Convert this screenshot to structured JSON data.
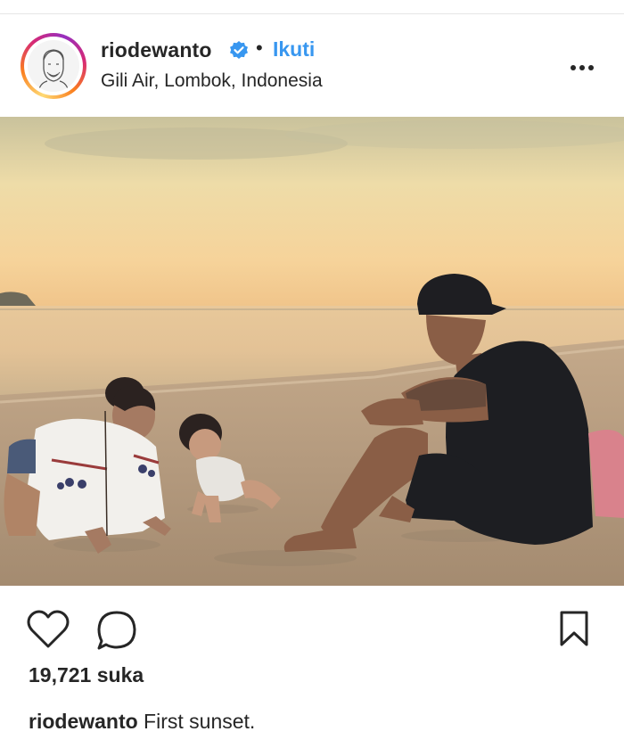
{
  "post": {
    "username": "riodewanto",
    "separator": "•",
    "follow_label": "Ikuti",
    "location": "Gili Air, Lombok, Indonesia",
    "more_icon": "more-horizontal-icon",
    "verified_icon": "verified-badge-icon"
  },
  "photo": {
    "subject": "family on beach at sunset"
  },
  "actions": {
    "like_icon": "heart-icon",
    "comment_icon": "comment-icon",
    "save_icon": "bookmark-icon"
  },
  "likes": {
    "text": "19,721 suka"
  },
  "caption": {
    "username": "riodewanto",
    "text": " First sunset."
  },
  "colors": {
    "accent": "#3897f0",
    "text": "#262626",
    "ring_start": "#feda75",
    "ring_end": "#d62976"
  }
}
